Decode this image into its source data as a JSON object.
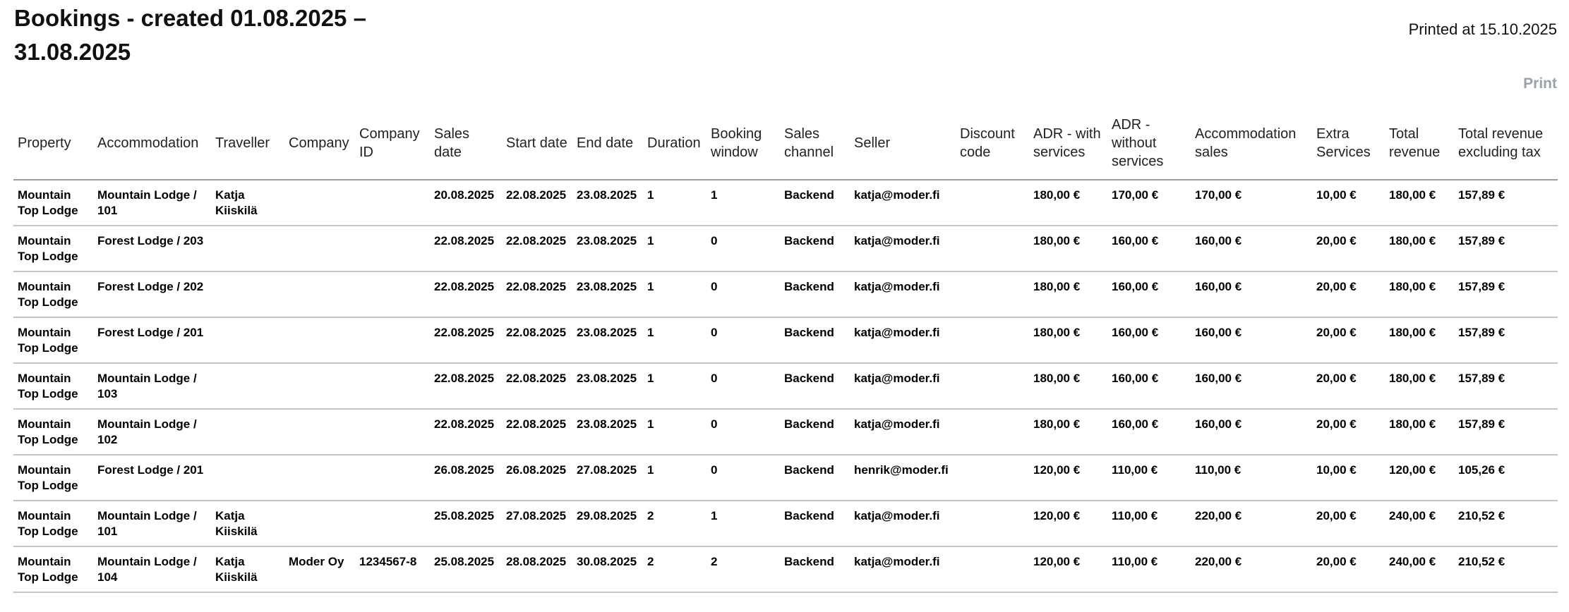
{
  "page": {
    "title": "Bookings - created 01.08.2025 – 31.08.2025",
    "printed_at": "Printed at 15.10.2025",
    "print_label": "Print"
  },
  "table": {
    "columns": [
      "Property",
      "Accommodation",
      "Traveller",
      "Company",
      "Company ID",
      "Sales date",
      "Start date",
      "End date",
      "Duration",
      "Booking window",
      "Sales channel",
      "Seller",
      "Discount code",
      "ADR - with services",
      "ADR - without services",
      "Accommodation sales",
      "Extra Services",
      "Total revenue",
      "Total revenue excluding tax"
    ],
    "rows": [
      [
        "Mountain Top Lodge",
        "Mountain Lodge / 101",
        "Katja Kiiskilä",
        "",
        "",
        "20.08.2025",
        "22.08.2025",
        "23.08.2025",
        "1",
        "1",
        "Backend",
        "katja@moder.fi",
        "",
        "180,00 €",
        "170,00 €",
        "170,00 €",
        "10,00 €",
        "180,00 €",
        "157,89 €"
      ],
      [
        "Mountain Top Lodge",
        "Forest Lodge / 203",
        "",
        "",
        "",
        "22.08.2025",
        "22.08.2025",
        "23.08.2025",
        "1",
        "0",
        "Backend",
        "katja@moder.fi",
        "",
        "180,00 €",
        "160,00 €",
        "160,00 €",
        "20,00 €",
        "180,00 €",
        "157,89 €"
      ],
      [
        "Mountain Top Lodge",
        "Forest Lodge / 202",
        "",
        "",
        "",
        "22.08.2025",
        "22.08.2025",
        "23.08.2025",
        "1",
        "0",
        "Backend",
        "katja@moder.fi",
        "",
        "180,00 €",
        "160,00 €",
        "160,00 €",
        "20,00 €",
        "180,00 €",
        "157,89 €"
      ],
      [
        "Mountain Top Lodge",
        "Forest Lodge / 201",
        "",
        "",
        "",
        "22.08.2025",
        "22.08.2025",
        "23.08.2025",
        "1",
        "0",
        "Backend",
        "katja@moder.fi",
        "",
        "180,00 €",
        "160,00 €",
        "160,00 €",
        "20,00 €",
        "180,00 €",
        "157,89 €"
      ],
      [
        "Mountain Top Lodge",
        "Mountain Lodge / 103",
        "",
        "",
        "",
        "22.08.2025",
        "22.08.2025",
        "23.08.2025",
        "1",
        "0",
        "Backend",
        "katja@moder.fi",
        "",
        "180,00 €",
        "160,00 €",
        "160,00 €",
        "20,00 €",
        "180,00 €",
        "157,89 €"
      ],
      [
        "Mountain Top Lodge",
        "Mountain Lodge / 102",
        "",
        "",
        "",
        "22.08.2025",
        "22.08.2025",
        "23.08.2025",
        "1",
        "0",
        "Backend",
        "katja@moder.fi",
        "",
        "180,00 €",
        "160,00 €",
        "160,00 €",
        "20,00 €",
        "180,00 €",
        "157,89 €"
      ],
      [
        "Mountain Top Lodge",
        "Forest Lodge / 201",
        "",
        "",
        "",
        "26.08.2025",
        "26.08.2025",
        "27.08.2025",
        "1",
        "0",
        "Backend",
        "henrik@moder.fi",
        "",
        "120,00 €",
        "110,00 €",
        "110,00 €",
        "10,00 €",
        "120,00 €",
        "105,26 €"
      ],
      [
        "Mountain Top Lodge",
        "Mountain Lodge / 101",
        "Katja Kiiskilä",
        "",
        "",
        "25.08.2025",
        "27.08.2025",
        "29.08.2025",
        "2",
        "1",
        "Backend",
        "katja@moder.fi",
        "",
        "120,00 €",
        "110,00 €",
        "220,00 €",
        "20,00 €",
        "240,00 €",
        "210,52 €"
      ],
      [
        "Mountain Top Lodge",
        "Mountain Lodge / 104",
        "Katja Kiiskilä",
        "Moder Oy",
        "1234567-8",
        "25.08.2025",
        "28.08.2025",
        "30.08.2025",
        "2",
        "2",
        "Backend",
        "katja@moder.fi",
        "",
        "120,00 €",
        "110,00 €",
        "220,00 €",
        "20,00 €",
        "240,00 €",
        "210,52 €"
      ]
    ]
  }
}
